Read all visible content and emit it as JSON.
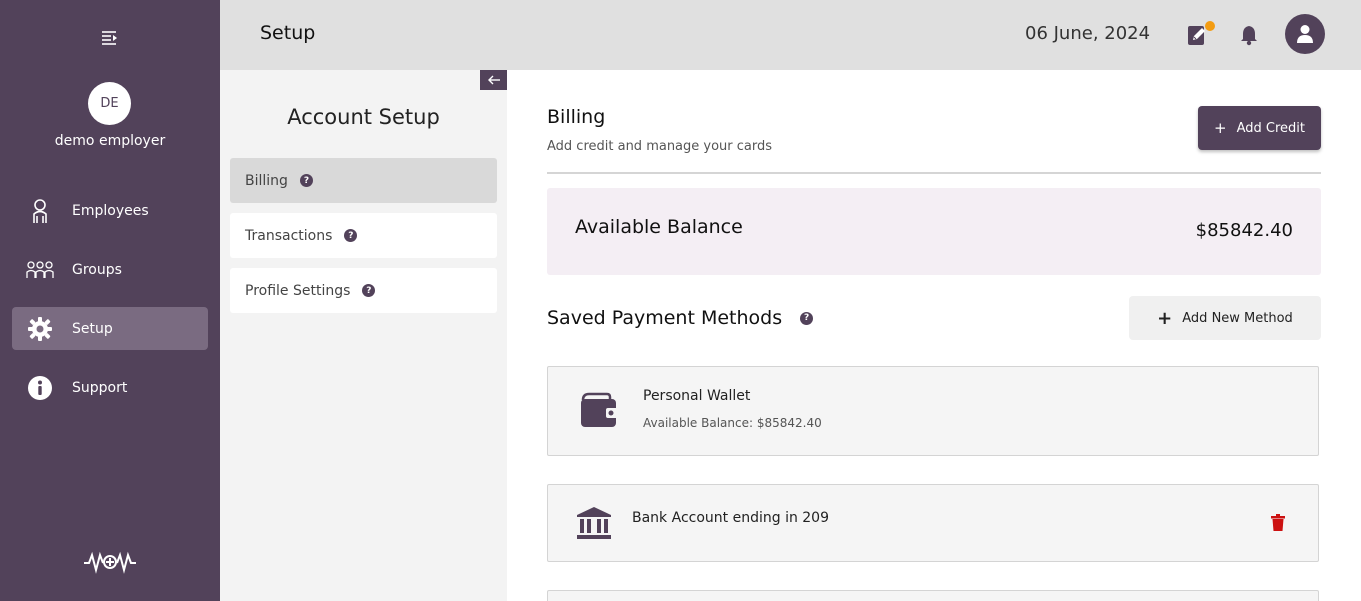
{
  "sidebar": {
    "user_initials": "DE",
    "user_name": "demo employer",
    "items": [
      {
        "label": "Employees",
        "icon": "employee-icon"
      },
      {
        "label": "Groups",
        "icon": "groups-icon"
      },
      {
        "label": "Setup",
        "icon": "gear-icon",
        "active": true
      },
      {
        "label": "Support",
        "icon": "info-icon"
      }
    ],
    "bg_color": "#52425a",
    "active_color": "#7a6b81"
  },
  "header": {
    "title": "Setup",
    "date": "06 June, 2024",
    "icons": [
      "edit-icon",
      "bell-icon",
      "profile-icon"
    ],
    "notify_color": "#f39c12"
  },
  "panel": {
    "title": "Account Setup",
    "items": [
      {
        "label": "Billing",
        "active": true
      },
      {
        "label": "Transactions"
      },
      {
        "label": "Profile Settings"
      }
    ],
    "help_glyph": "?"
  },
  "billing": {
    "title": "Billing",
    "subtitle": "Add credit and manage your cards",
    "add_credit_label": "Add Credit",
    "balance_label": "Available Balance",
    "balance_value": "$85842.40",
    "saved_title": "Saved Payment Methods",
    "add_method_label": "Add New Method",
    "methods": [
      {
        "title": "Personal Wallet",
        "subtitle": "Available Balance: $85842.40",
        "icon": "wallet-icon"
      },
      {
        "title": "Bank Account ending in 209",
        "icon": "bank-icon",
        "action_icon": "trash-icon"
      }
    ],
    "accent_color": "#52425a",
    "balance_bg": "#f4eef4",
    "delete_color": "#cc1111"
  }
}
